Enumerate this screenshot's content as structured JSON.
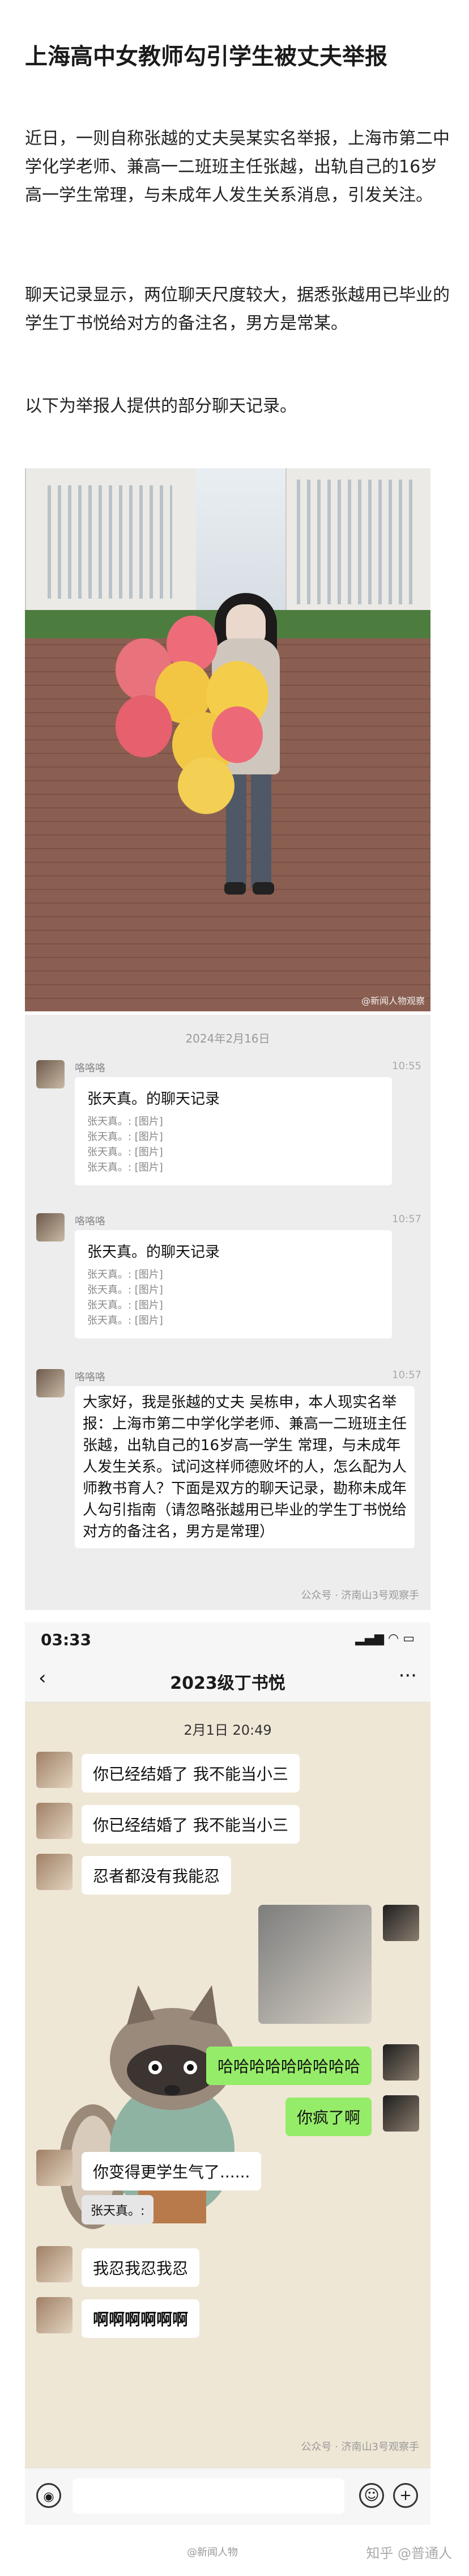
{
  "article": {
    "title": "上海高中女教师勾引学生被丈夫举报",
    "para1": "近日，一则自称张越的丈夫吴某实名举报，上海市第二中学化学老师、兼高一二班班主任张越，出轨自己的16岁高一学生常理，与未成年人发生关系消息，引发关注。",
    "para2": "聊天记录显示，两位聊天尺度较大，据悉张越用已毕业的学生丁书悦给对方的备注名，男方是常某。",
    "para3": "以下为举报人提供的部分聊天记录。"
  },
  "photo": {
    "watermark": "@新闻人物观察"
  },
  "chat1": {
    "date": "2024年2月16日",
    "messages": [
      {
        "sender": "咯咯咯",
        "time": "10:55",
        "card_title": "张天真。的聊天记录",
        "lines": [
          "张天真。: [图片]",
          "张天真。: [图片]",
          "张天真。: [图片]",
          "张天真。: [图片]"
        ]
      },
      {
        "sender": "咯咯咯",
        "time": "10:57",
        "card_title": "张天真。的聊天记录",
        "lines": [
          "张天真。: [图片]",
          "张天真。: [图片]",
          "张天真。: [图片]",
          "张天真。: [图片]"
        ]
      },
      {
        "sender": "咯咯咯",
        "time": "10:57",
        "text": "大家好，我是张越的丈夫 吴栋申，本人现实名举报：上海市第二中学化学老师、兼高一二班班主任 张越，出轨自己的16岁高一学生 常理，与未成年人发生关系。试问这样师德败坏的人，怎么配为人师教书育人？下面是双方的聊天记录，勘称未成年人勾引指南（请忽略张越用已毕业的学生丁书悦给对方的备注名，男方是常理）"
      }
    ],
    "watermark": "公众号 · 济南山3号观察手"
  },
  "phone": {
    "status_time": "03:33",
    "status_icons": "▂▄▆ ◠ ▭",
    "back_label": "‹",
    "title": "2023级丁书悦",
    "more_label": "···",
    "date": "2月1日 20:49",
    "bubbles": [
      {
        "side": "left",
        "text": "你已经结婚了 我不能当小三"
      },
      {
        "side": "left",
        "text": "你已经结婚了 我不能当小三"
      },
      {
        "side": "left",
        "text": "忍者都没有我能忍"
      },
      {
        "side": "right",
        "text": "哈哈哈哈哈哈哈哈哈"
      },
      {
        "side": "right",
        "text": "你疯了啊"
      },
      {
        "side": "left",
        "text": "你变得更学生气了......"
      },
      {
        "side": "left",
        "text": "张天真。:"
      },
      {
        "side": "left",
        "text": "我忍我忍我忍"
      },
      {
        "side": "left",
        "text": "啊啊啊啊啊啊"
      }
    ],
    "voice_icon": "◉",
    "emoji_icon": "☺",
    "plus_icon": "+",
    "watermark": "公众号 · 济南山3号观察手"
  },
  "footer": {
    "weibo_wm": "@新闻人物",
    "zhihu": "知乎 @普通人"
  },
  "colors": {
    "my_bubble": "#95ec69",
    "chat_bg": "#efe7d6"
  }
}
